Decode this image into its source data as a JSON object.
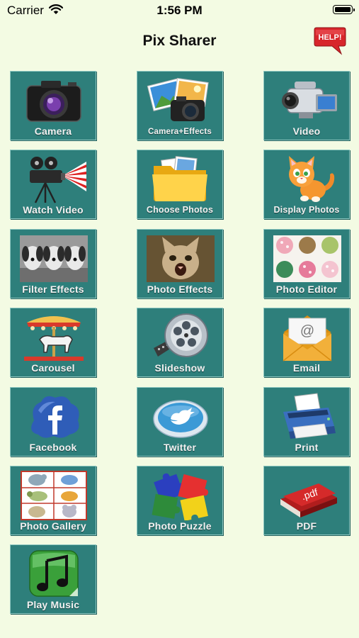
{
  "status_bar": {
    "carrier": "Carrier",
    "time": "1:56 PM"
  },
  "nav": {
    "title": "Pix Sharer",
    "help_label": "HELP!"
  },
  "tiles": [
    {
      "label": "Camera",
      "icon": "camera-icon"
    },
    {
      "label": "Camera+Effects",
      "icon": "camera-effects-icon"
    },
    {
      "label": "Video",
      "icon": "video-camera-icon"
    },
    {
      "label": "Watch Video",
      "icon": "projector-icon"
    },
    {
      "label": "Choose Photos",
      "icon": "folder-icon"
    },
    {
      "label": "Display Photos",
      "icon": "kitten-icon"
    },
    {
      "label": "Filter Effects",
      "icon": "puppies-photo-icon"
    },
    {
      "label": "Photo Effects",
      "icon": "cat-photo-icon"
    },
    {
      "label": "Photo Editor",
      "icon": "cupcakes-photo-icon"
    },
    {
      "label": "Carousel",
      "icon": "carousel-icon"
    },
    {
      "label": "Slideshow",
      "icon": "film-reel-icon"
    },
    {
      "label": "Email",
      "icon": "email-envelope-icon"
    },
    {
      "label": "Facebook",
      "icon": "facebook-icon"
    },
    {
      "label": "Twitter",
      "icon": "twitter-bird-icon"
    },
    {
      "label": "Print",
      "icon": "printer-icon"
    },
    {
      "label": "Photo Gallery",
      "icon": "gallery-grid-icon"
    },
    {
      "label": "Photo Puzzle",
      "icon": "puzzle-pieces-icon"
    },
    {
      "label": "PDF",
      "icon": "pdf-book-icon",
      "art_text": ".pdf"
    },
    {
      "label": "Play Music",
      "icon": "music-note-icon"
    }
  ],
  "colors": {
    "background": "#f3fbe3",
    "tile": "#2e7f7b",
    "tile_label": "#f2f2f2",
    "help_red": "#d7262b"
  }
}
